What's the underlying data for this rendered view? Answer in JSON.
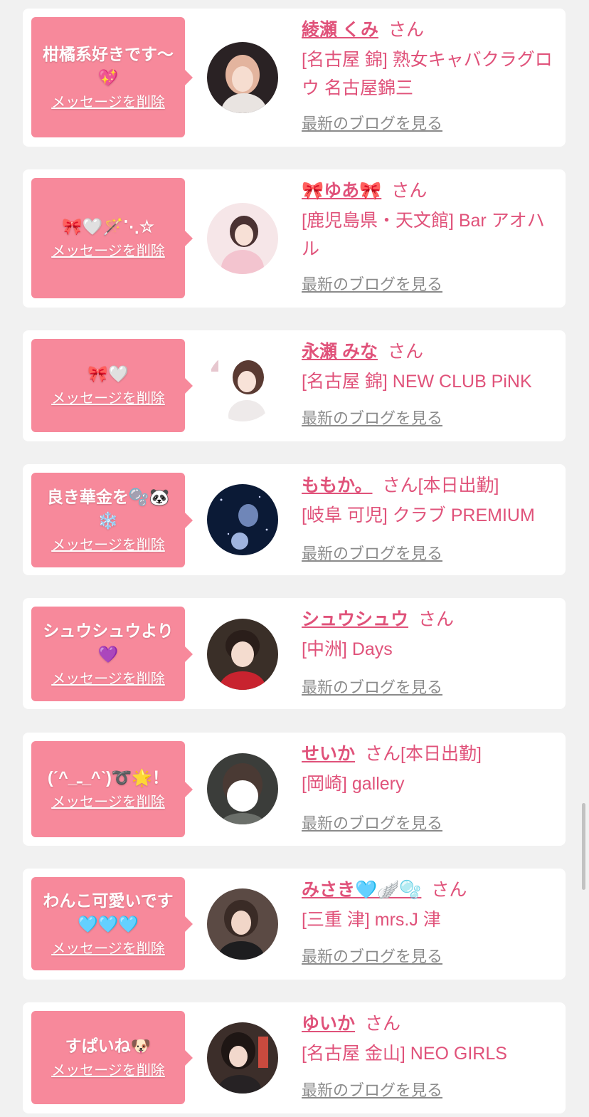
{
  "san_label": "さん",
  "delete_label": "メッセージを削除",
  "blog_label": "最新のブログを見る",
  "colors": {
    "bubble": "#f7899b",
    "name": "#e0527a",
    "shop": "#e0527a",
    "blog_link": "#8b8b8b",
    "background": "#f1f1f1",
    "card": "#ffffff"
  },
  "cards": [
    {
      "message": "柑橘系好きです〜💖",
      "name": "綾瀬 くみ",
      "status": "",
      "shop": "[名古屋 錦] 熟女キャバクラグロウ 名古屋錦三"
    },
    {
      "message": "🎀🤍🪄⋱☆",
      "name": "🎀ゆあ🎀",
      "status": "",
      "shop": "[鹿児島県・天文館] Bar アオハル"
    },
    {
      "message": "🎀🤍",
      "name": "永瀬 みな",
      "status": "",
      "shop": "[名古屋 錦] NEW CLUB PiNK"
    },
    {
      "message": "良き華金を🫧🐼❄️",
      "name": "ももか。",
      "status": "[本日出勤]",
      "shop": "[岐阜 可児] クラブ PREMIUM"
    },
    {
      "message": "シュウシュウより💜",
      "name": "シュウシュウ",
      "status": "",
      "shop": "[中洲] Days"
    },
    {
      "message": "(ˊ^_ـ_^ˋ)➰🌟！",
      "name": "せいか",
      "status": "[本日出勤]",
      "shop": "[岡崎] gallery"
    },
    {
      "message": "わんこ可愛いです🩵🩵🩵",
      "name": "みさき🩵🪽🫧",
      "status": "",
      "shop": "[三重 津] mrs.J 津"
    },
    {
      "message": "すぱいね🐶",
      "name": "ゆいか",
      "status": "",
      "shop": "[名古屋 金山] NEO GIRLS"
    }
  ]
}
